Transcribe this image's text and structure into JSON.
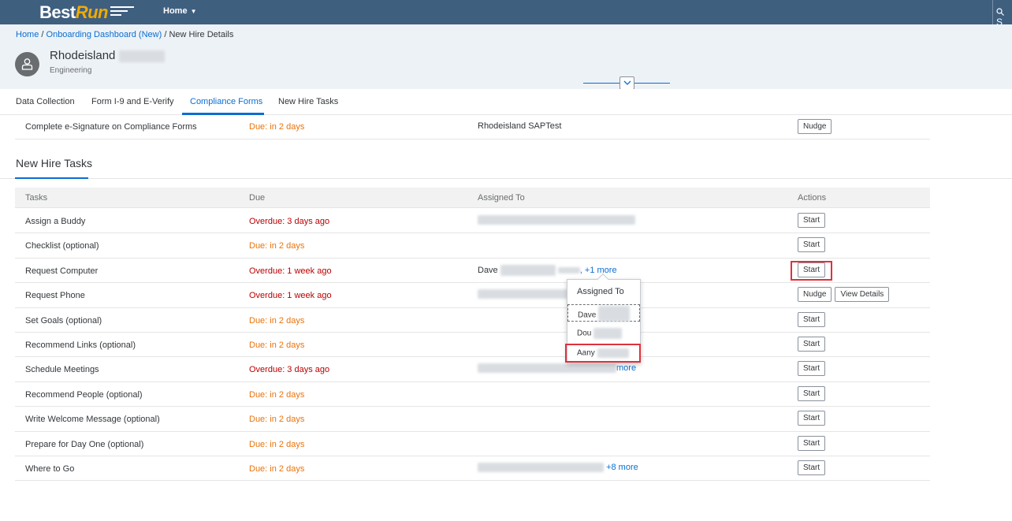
{
  "shell": {
    "logo_best": "Best",
    "logo_run": "Run",
    "home_label": "Home",
    "search_glyph": "S"
  },
  "breadcrumb": {
    "home": "Home",
    "separator": " / ",
    "dashboard": "Onboarding Dashboard (New)",
    "current": "New Hire Details"
  },
  "person": {
    "first_name": "Rhodeisland",
    "department": "Engineering"
  },
  "tabs": [
    {
      "label": "Data Collection",
      "active": false
    },
    {
      "label": "Form I-9 and E-Verify",
      "active": false
    },
    {
      "label": "Compliance Forms",
      "active": true
    },
    {
      "label": "New Hire Tasks",
      "active": false
    }
  ],
  "compliance_row": {
    "task": "Complete e-Signature on Compliance Forms",
    "due": "Due: in 2 days",
    "assigned": "Rhodeisland SAPTest",
    "action": "Nudge"
  },
  "section_title": "New Hire Tasks",
  "table": {
    "headers": {
      "tasks": "Tasks",
      "due": "Due",
      "assigned": "Assigned To",
      "actions": "Actions"
    },
    "rows": [
      {
        "task": "Assign a Buddy",
        "due": "Overdue: 3 days ago",
        "status": "over",
        "action": "Start"
      },
      {
        "task": "Checklist (optional)",
        "due": "Due: in 2 days",
        "status": "ok",
        "action": "Start"
      },
      {
        "task": "Request Computer",
        "due": "Overdue: 1 week ago",
        "status": "over",
        "assigned_name": "Dave",
        "assigned_more": ", +1 more",
        "action": "Start"
      },
      {
        "task": "Request Phone",
        "due": "Overdue: 1 week ago",
        "status": "over",
        "action": "Nudge",
        "action2": "View Details"
      },
      {
        "task": "Set Goals (optional)",
        "due": "Due: in 2 days",
        "status": "ok",
        "action": "Start"
      },
      {
        "task": "Recommend Links (optional)",
        "due": "Due: in 2 days",
        "status": "ok",
        "action": "Start"
      },
      {
        "task": "Schedule Meetings",
        "due": "Overdue: 3 days ago",
        "status": "over",
        "assigned_more": "more",
        "action": "Start"
      },
      {
        "task": "Recommend People (optional)",
        "due": "Due: in 2 days",
        "status": "ok",
        "action": "Start"
      },
      {
        "task": "Write Welcome Message (optional)",
        "due": "Due: in 2 days",
        "status": "ok",
        "action": "Start"
      },
      {
        "task": "Prepare for Day One (optional)",
        "due": "Due: in 2 days",
        "status": "ok",
        "action": "Start"
      },
      {
        "task": "Where to Go",
        "due": "Due: in 2 days",
        "status": "ok",
        "assigned_more": "+8 more",
        "action": "Start"
      }
    ]
  },
  "popover": {
    "title": "Assigned To",
    "items": [
      "Dave",
      "Dou",
      "Aany"
    ]
  },
  "colors": {
    "shell": "#3f5f7f",
    "accent": "#0a6ed1",
    "overdue": "#bb0000",
    "due": "#e9730c",
    "highlight": "#e0313c"
  }
}
